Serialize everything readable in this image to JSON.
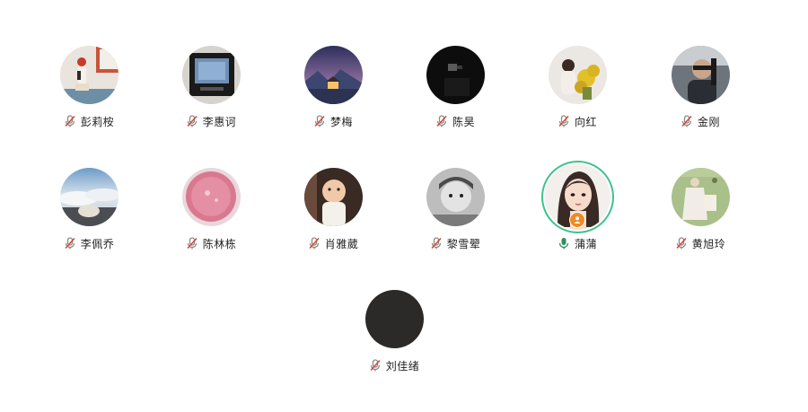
{
  "participants": [
    {
      "name": "彭莉桉",
      "mic": "mic-muted-icon",
      "avatar": "figurine-photo"
    },
    {
      "name": "李惠诃",
      "mic": "mic-muted-icon",
      "avatar": "tv-photo"
    },
    {
      "name": "梦梅",
      "mic": "mic-muted-icon",
      "avatar": "night-cabin-photo"
    },
    {
      "name": "陈昊",
      "mic": "mic-muted-icon",
      "avatar": "dark-room-photo"
    },
    {
      "name": "向红",
      "mic": "mic-muted-icon",
      "avatar": "flowers-photo"
    },
    {
      "name": "金刚",
      "mic": "mic-muted-icon",
      "avatar": "driver-photo"
    },
    {
      "name": "李佩乔",
      "mic": "mic-muted-icon",
      "avatar": "clouds-window-photo"
    },
    {
      "name": "陈林栋",
      "mic": "mic-muted-icon",
      "avatar": "pink-drink-photo"
    },
    {
      "name": "肖雅葳",
      "mic": "mic-muted-icon",
      "avatar": "toddler-photo"
    },
    {
      "name": "黎雪翚",
      "mic": "mic-muted-icon",
      "avatar": "baby-bw-photo"
    },
    {
      "name": "蒲蒲",
      "mic": "mic-active-icon",
      "avatar": "illustrated-girl-avatar",
      "speaking": true,
      "host": true
    },
    {
      "name": "黄旭玲",
      "mic": "mic-muted-icon",
      "avatar": "painting-photo"
    },
    {
      "name": "刘佳绪",
      "mic": "mic-muted-icon",
      "avatar": "dark-avatar"
    }
  ],
  "colors": {
    "speaking_ring": "#3fc28e",
    "host_badge": "#f08a24",
    "muted_mic": "#d9442f",
    "active_mic": "#2f8f5b"
  }
}
